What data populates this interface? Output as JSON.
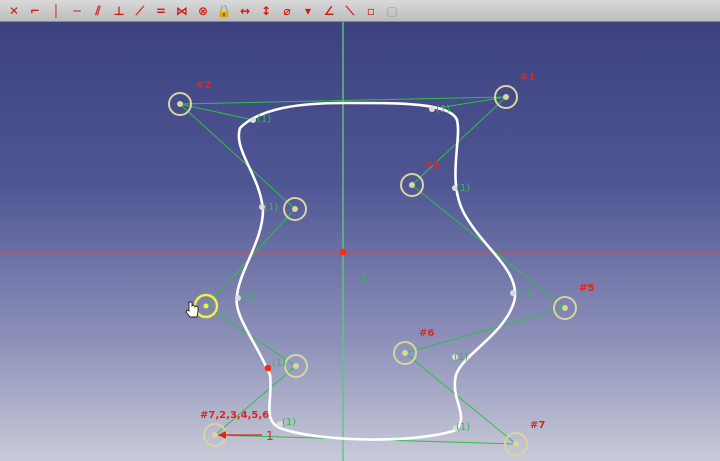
{
  "toolbar": {
    "tools": [
      {
        "name": "coincident-constraint-icon",
        "glyph": "✕"
      },
      {
        "name": "point-on-object-constraint-icon",
        "glyph": "⌐"
      },
      {
        "name": "vertical-constraint-icon",
        "glyph": "│"
      },
      {
        "name": "horizontal-constraint-icon",
        "glyph": "─"
      },
      {
        "name": "parallel-constraint-icon",
        "glyph": "⫽"
      },
      {
        "name": "perpendicular-constraint-icon",
        "glyph": "⊥"
      },
      {
        "name": "tangent-constraint-icon",
        "glyph": "⟋"
      },
      {
        "name": "equal-constraint-icon",
        "glyph": "="
      },
      {
        "name": "symmetric-constraint-icon",
        "glyph": "⋈"
      },
      {
        "name": "block-constraint-icon",
        "glyph": "⊗"
      },
      {
        "name": "lock-constraint-icon",
        "glyph": "🔒"
      },
      {
        "name": "horizontal-distance-icon",
        "glyph": "↔"
      },
      {
        "name": "vertical-distance-icon",
        "glyph": "↕"
      },
      {
        "name": "radius-constraint-icon",
        "glyph": "⌀"
      },
      {
        "name": "radius-dropdown-icon",
        "glyph": "▾"
      },
      {
        "name": "angle-constraint-icon",
        "glyph": "∠"
      },
      {
        "name": "refraction-constraint-icon",
        "glyph": "⟍"
      },
      {
        "name": "toggle-driving-icon",
        "glyph": "▫"
      },
      {
        "name": "toggle-active-icon",
        "glyph": "▢",
        "dim": true
      }
    ]
  },
  "sketch": {
    "pole_labels": {
      "p1": "#1",
      "p2": "#2",
      "p4": "#4",
      "p5": "#5",
      "p6": "#6",
      "p7": "#7",
      "p_origin": "#7,2,3,4,5,6"
    },
    "constraint_label": "(1)",
    "axis_dimension": "3",
    "origin_dimension": "1",
    "colors": {
      "curve": "#ffffff",
      "control_polygon": "#2fbf45",
      "pole": "#d8d5a0",
      "pole_selected": "#f2f23a",
      "axis_vertical": "#5fc77d",
      "axis_horizontal": "#d24a4a",
      "label_red": "#e0241c",
      "label_green": "#2fbf45"
    }
  }
}
